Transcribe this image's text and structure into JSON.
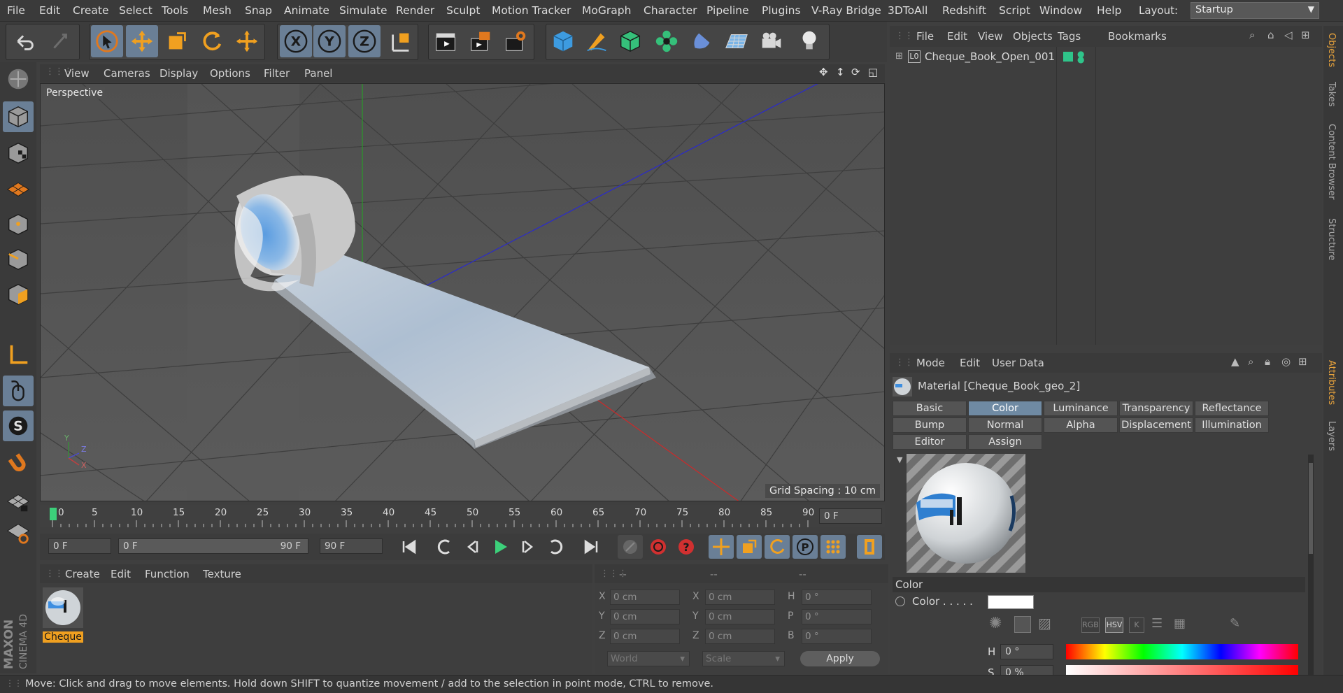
{
  "menubar": {
    "items": [
      "File",
      "Edit",
      "Create",
      "Select",
      "Tools",
      "Mesh",
      "Snap",
      "Animate",
      "Simulate",
      "Render",
      "Sculpt",
      "Motion Tracker",
      "MoGraph",
      "Character",
      "Pipeline",
      "Plugins",
      "V-Ray Bridge",
      "3DToAll",
      "Redshift",
      "Script",
      "Window",
      "Help"
    ],
    "layout_label": "Layout:",
    "layout_value": "Startup"
  },
  "toolbar": {
    "axis_x": "X",
    "axis_y": "Y",
    "axis_z": "Z"
  },
  "viewport": {
    "menu": [
      "View",
      "Cameras",
      "Display",
      "Options",
      "Filter",
      "Panel"
    ],
    "label": "Perspective",
    "grid_spacing": "Grid Spacing : 10 cm",
    "axis_y": "Y",
    "axis_z": "Z",
    "axis_x": "X"
  },
  "timeline": {
    "ticks": [
      "0",
      "5",
      "10",
      "15",
      "20",
      "25",
      "30",
      "35",
      "40",
      "45",
      "50",
      "55",
      "60",
      "65",
      "70",
      "75",
      "80",
      "85",
      "90"
    ],
    "current_frame": "0 F"
  },
  "transport": {
    "start_field": "0 F",
    "range_start": "0 F",
    "range_end": "90 F",
    "end_field": "90 F"
  },
  "material_manager": {
    "menu": [
      "Create",
      "Edit",
      "Function",
      "Texture"
    ],
    "material_name": "Cheque"
  },
  "coordinates": {
    "headers": [
      "--",
      "--",
      "--"
    ],
    "rows": [
      {
        "l1": "X",
        "v1": "0 cm",
        "l2": "X",
        "v2": "0 cm",
        "l3": "H",
        "v3": "0 °"
      },
      {
        "l1": "Y",
        "v1": "0 cm",
        "l2": "Y",
        "v2": "0 cm",
        "l3": "P",
        "v3": "0 °"
      },
      {
        "l1": "Z",
        "v1": "0 cm",
        "l2": "Z",
        "v2": "0 cm",
        "l3": "B",
        "v3": "0 °"
      }
    ],
    "mode_select": "World",
    "scale_select": "Scale",
    "apply_label": "Apply"
  },
  "object_manager": {
    "menu": [
      "File",
      "Edit",
      "View",
      "Objects",
      "Tags",
      "Bookmarks"
    ],
    "object_name": "Cheque_Book_Open_001",
    "object_badge": "L0"
  },
  "attribute_manager": {
    "menu": [
      "Mode",
      "Edit",
      "User Data"
    ],
    "title": "Material [Cheque_Book_geo_2]",
    "tabs_row1": [
      "Basic",
      "Color",
      "Luminance",
      "Transparency",
      "Reflectance"
    ],
    "tabs_row2": [
      "Bump",
      "Normal",
      "Alpha",
      "Displacement",
      "Illumination"
    ],
    "tabs_row3": [
      "Editor",
      "Assign"
    ],
    "active_tab": "Color",
    "section_title": "Color",
    "color_label": "Color . . . . .",
    "mode_buttons": [
      "RGB",
      "HSV",
      "K"
    ],
    "h_label": "H",
    "h_value": "0 °",
    "s_label": "S",
    "s_value": "0 %"
  },
  "right_strip": {
    "top": [
      "Objects",
      "Takes",
      "Content Browser",
      "Structure"
    ],
    "bottom": [
      "Attributes",
      "Layers"
    ]
  },
  "status": {
    "text": "Move: Click and drag to move elements. Hold down SHIFT to quantize movement / add to the selection in point mode, CTRL to remove."
  },
  "brand": {
    "line1": "MAXON",
    "line2": "CINEMA 4D"
  },
  "colors": {
    "accent": "#6a7f96",
    "active_tab": "#6f8aa3",
    "object_tag": "#2fc48a",
    "orange_label": "#e8a33c"
  }
}
